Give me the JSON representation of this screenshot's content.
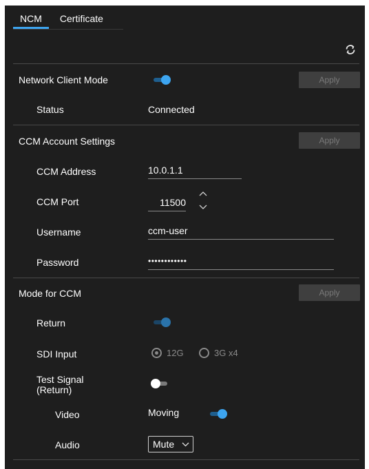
{
  "tabs": [
    {
      "label": "NCM",
      "active": true
    },
    {
      "label": "Certificate",
      "active": false
    }
  ],
  "toolbar": {
    "refresh_icon": "refresh-icon"
  },
  "network_client_mode": {
    "label": "Network Client Mode",
    "enabled": true,
    "apply_label": "Apply",
    "status_label": "Status",
    "status_value": "Connected"
  },
  "ccm_account": {
    "title": "CCM Account Settings",
    "apply_label": "Apply",
    "address_label": "CCM Address",
    "address_value": "10.0.1.1",
    "port_label": "CCM Port",
    "port_value": "11500",
    "username_label": "Username",
    "username_value": "ccm-user",
    "password_label": "Password",
    "password_value": "••••••••••••"
  },
  "mode_for_ccm": {
    "title": "Mode for CCM",
    "apply_label": "Apply",
    "return_label": "Return",
    "return_enabled": true,
    "sdi_label": "SDI Input",
    "sdi_options": [
      "12G",
      "3G x4"
    ],
    "sdi_selected": "12G",
    "test_signal_label_1": "Test Signal",
    "test_signal_label_2": "(Return)",
    "test_signal_enabled": false,
    "video_label": "Video",
    "video_value": "Moving",
    "video_enabled": true,
    "audio_label": "Audio",
    "audio_value": "Mute"
  },
  "colors": {
    "panel_bg": "#1e1e1e",
    "accent": "#3da5f0",
    "disabled_button": "#3f3f3f"
  }
}
